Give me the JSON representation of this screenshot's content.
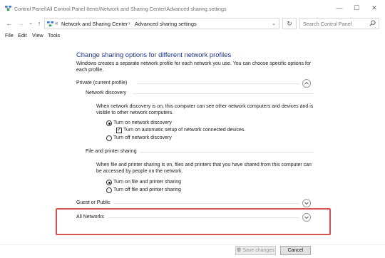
{
  "window": {
    "title": "Control Panel\\All Control Panel Items\\Network and Sharing Center\\Advanced sharing settings",
    "minimize": "—",
    "maximize": "☐",
    "close": "✕"
  },
  "address": {
    "back": "←",
    "forward": "→",
    "recent": "⌄",
    "up": "↑",
    "crumb_sep": "›",
    "crumb_overflow": "«",
    "crumbs": [
      "Network and Sharing Center",
      "Advanced sharing settings"
    ],
    "dropdown": "⌄",
    "refresh": "↻",
    "search_placeholder": "Search Control Panel"
  },
  "menu": {
    "items": [
      "File",
      "Edit",
      "View",
      "Tools"
    ]
  },
  "content": {
    "heading": "Change sharing options for different network profiles",
    "intro": "Windows creates a separate network profile for each network you use. You can choose specific options for each profile.",
    "private": {
      "label": "Private (current profile)",
      "discovery": {
        "title": "Network discovery",
        "description": "When network discovery is on, this computer can see other network computers and devices and is visible to other network computers.",
        "options": [
          "Turn on network discovery",
          "Turn off network discovery"
        ],
        "selected": 0,
        "auto_setup_label": "Turn on automatic setup of network connected devices.",
        "auto_setup_checked": true
      },
      "file_sharing": {
        "title": "File and printer sharing",
        "description": "When file and printer sharing is on, files and printers that you have shared from this computer can be accessed by people on the network.",
        "options": [
          "Turn on file and printer sharing",
          "Turn off file and printer sharing"
        ],
        "selected": 0
      }
    },
    "guest": {
      "label": "Guest or Public"
    },
    "all_networks": {
      "label": "All Networks"
    }
  },
  "footer": {
    "save_label": "Save changes",
    "cancel_label": "Cancel"
  },
  "colors": {
    "heading": "#1e3287",
    "highlight": "#d45252"
  },
  "icons": {
    "app": "network-sharing-icon",
    "search": "search-icon",
    "chevron_expanded": "chevron-up-icon",
    "chevron_collapsed": "chevron-down-icon",
    "save_shield": "uac-shield-icon"
  }
}
